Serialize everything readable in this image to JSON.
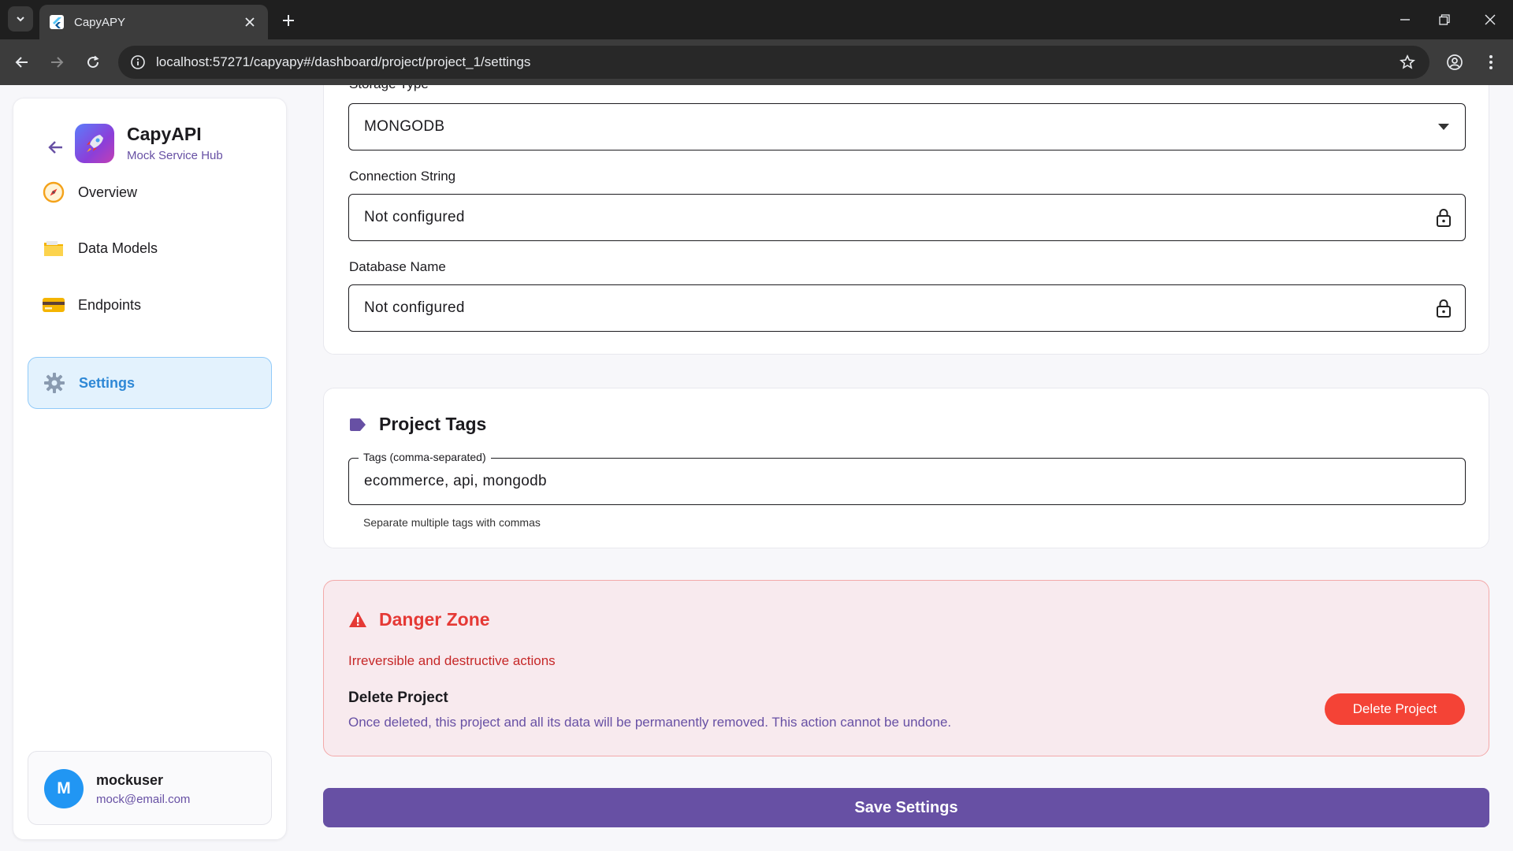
{
  "browser": {
    "tab_title": "CapyAPY",
    "url": "localhost:57271/capyapy#/dashboard/project/project_1/settings"
  },
  "sidebar": {
    "app_name": "CapyAPI",
    "app_subtitle": "Mock Service Hub",
    "items": [
      {
        "label": "Overview",
        "icon": "compass-icon",
        "active": false
      },
      {
        "label": "Data Models",
        "icon": "folder-icon",
        "active": false
      },
      {
        "label": "Endpoints",
        "icon": "credit-card-icon",
        "active": false
      },
      {
        "label": "Settings",
        "icon": "gear-icon",
        "active": true
      }
    ],
    "user": {
      "initial": "M",
      "name": "mockuser",
      "email": "mock@email.com"
    }
  },
  "storage": {
    "type_label": "Storage Type",
    "type_value": "MONGODB",
    "connection_label": "Connection String",
    "connection_value": "Not configured",
    "dbname_label": "Database Name",
    "dbname_value": "Not configured"
  },
  "tags": {
    "title": "Project Tags",
    "field_label": "Tags (comma-separated)",
    "value": "ecommerce, api, mongodb",
    "helper": "Separate multiple tags with commas"
  },
  "danger": {
    "title": "Danger Zone",
    "description": "Irreversible and destructive actions",
    "delete_heading": "Delete Project",
    "delete_description": "Once deleted, this project and all its data will be permanently removed. This action cannot be undone.",
    "delete_button": "Delete Project"
  },
  "save_button": "Save Settings",
  "colors": {
    "primary": "#6750a4",
    "danger": "#f44336",
    "active_nav": "#2e88d6"
  }
}
